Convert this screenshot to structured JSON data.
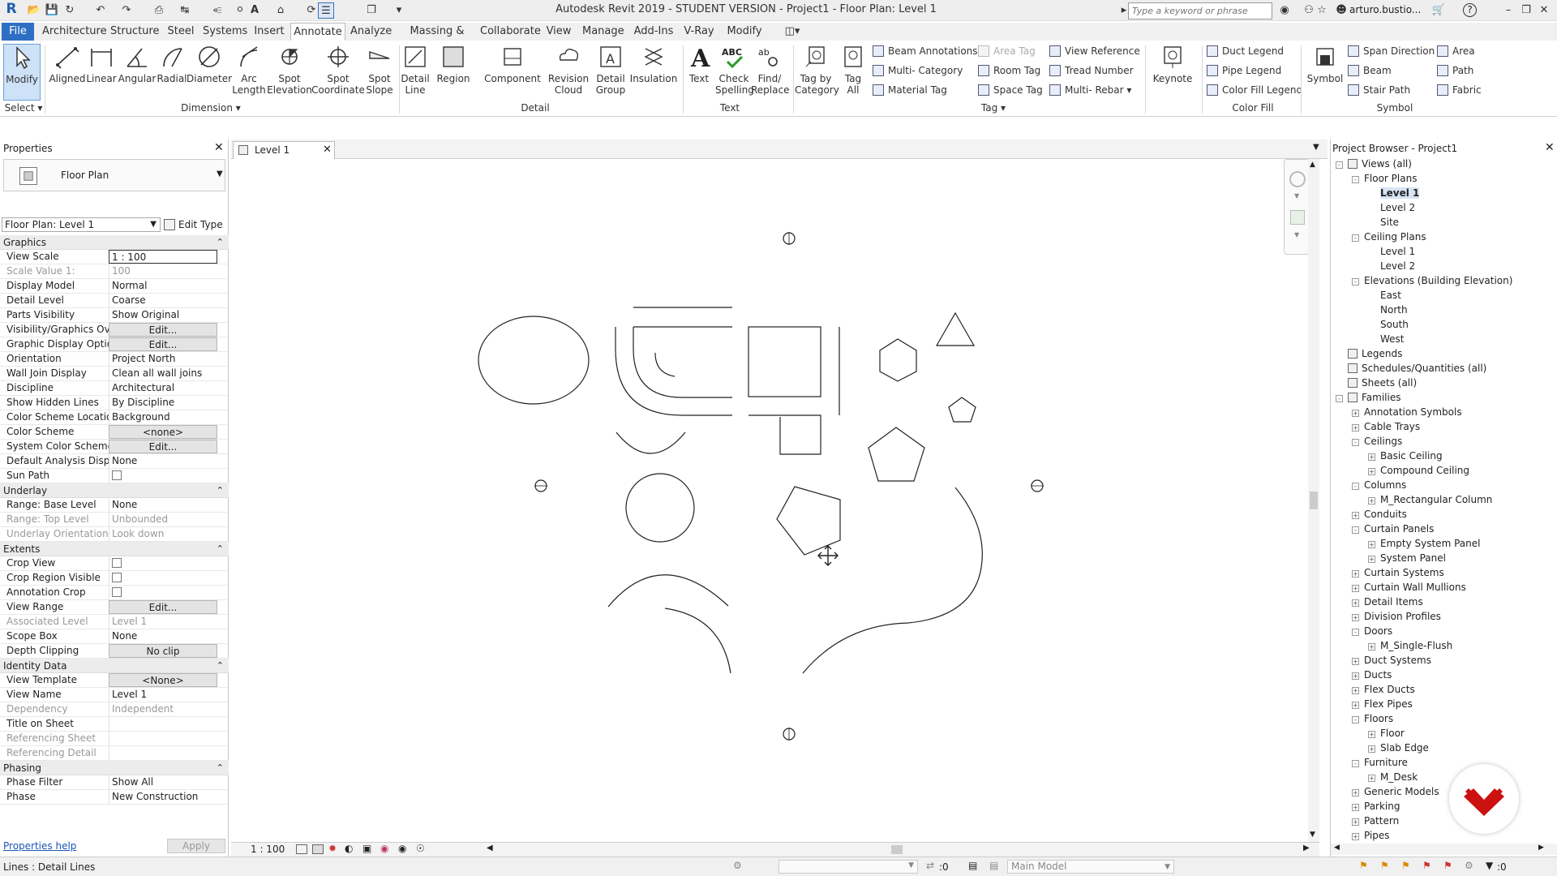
{
  "window": {
    "title": "Autodesk Revit 2019 - STUDENT VERSION - Project1 - Floor Plan: Level 1",
    "search_placeholder": "Type a keyword or phrase",
    "user": "arturo.bustio...",
    "help": "?",
    "logo": "R"
  },
  "tabs": [
    "File",
    "Architecture",
    "Structure",
    "Steel",
    "Systems",
    "Insert",
    "Annotate",
    "Analyze",
    "Massing & Site",
    "Collaborate",
    "View",
    "Manage",
    "Add-Ins",
    "V-Ray",
    "Modify"
  ],
  "active_tab": "Annotate",
  "ribbon": {
    "modify": "Modify",
    "dimension": [
      "Aligned",
      "Linear",
      "Angular",
      "Radial",
      "Diameter",
      "Arc\nLength",
      "Spot\nElevation",
      "Spot\nCoordinate",
      "Spot\nSlope"
    ],
    "detail": [
      "Detail\nLine",
      "Region",
      "Component",
      "Revision\nCloud",
      "Detail\nGroup",
      "Insulation"
    ],
    "text": [
      "Text",
      "Check\nSpelling",
      "Find/\nReplace"
    ],
    "tag_big": [
      "Tag by\nCategory",
      "Tag\nAll"
    ],
    "tag_small": [
      "Beam Annotations",
      "Multi- Category",
      "Material Tag",
      "Area Tag",
      "Room Tag",
      "Space Tag",
      "View Reference",
      "Tread Number",
      "Multi- Rebar"
    ],
    "keynote": "Keynote",
    "colorfill_small": [
      "Duct Legend",
      "Pipe Legend",
      "Color Fill Legend"
    ],
    "symbol": "Symbol",
    "symbol_small": [
      "Span Direction",
      "Beam",
      "Stair Path",
      "Area",
      "Path",
      "Fabric"
    ],
    "groups": [
      "Select",
      "Dimension",
      "Detail",
      "Text",
      "Tag",
      "Color Fill",
      "Symbol"
    ]
  },
  "properties": {
    "title": "Properties",
    "type_name": "Floor Plan",
    "selector": "Floor Plan: Level 1",
    "edit_type": "Edit Type",
    "sections": [
      {
        "name": "Graphics",
        "rows": [
          [
            "View Scale",
            "1 : 100"
          ],
          [
            "Scale Value    1:",
            "100"
          ],
          [
            "Display Model",
            "Normal"
          ],
          [
            "Detail Level",
            "Coarse"
          ],
          [
            "Parts Visibility",
            "Show Original"
          ],
          [
            "Visibility/Graphics Ov...",
            "Edit..."
          ],
          [
            "Graphic Display Optio...",
            "Edit..."
          ],
          [
            "Orientation",
            "Project North"
          ],
          [
            "Wall Join Display",
            "Clean all wall joins"
          ],
          [
            "Discipline",
            "Architectural"
          ],
          [
            "Show Hidden Lines",
            "By Discipline"
          ],
          [
            "Color Scheme Location",
            "Background"
          ],
          [
            "Color Scheme",
            "<none>"
          ],
          [
            "System Color Schemes",
            "Edit..."
          ],
          [
            "Default Analysis Displ...",
            "None"
          ],
          [
            "Sun Path",
            ""
          ]
        ]
      },
      {
        "name": "Underlay",
        "rows": [
          [
            "Range: Base Level",
            "None"
          ],
          [
            "Range: Top Level",
            "Unbounded"
          ],
          [
            "Underlay Orientation",
            "Look down"
          ]
        ]
      },
      {
        "name": "Extents",
        "rows": [
          [
            "Crop View",
            ""
          ],
          [
            "Crop Region Visible",
            ""
          ],
          [
            "Annotation Crop",
            ""
          ],
          [
            "View Range",
            "Edit..."
          ],
          [
            "Associated Level",
            "Level 1"
          ],
          [
            "Scope Box",
            "None"
          ],
          [
            "Depth Clipping",
            "No clip"
          ]
        ]
      },
      {
        "name": "Identity Data",
        "rows": [
          [
            "View Template",
            "<None>"
          ],
          [
            "View Name",
            "Level 1"
          ],
          [
            "Dependency",
            "Independent"
          ],
          [
            "Title on Sheet",
            ""
          ],
          [
            "Referencing Sheet",
            ""
          ],
          [
            "Referencing Detail",
            ""
          ]
        ]
      },
      {
        "name": "Phasing",
        "rows": [
          [
            "Phase Filter",
            "Show All"
          ],
          [
            "Phase",
            "New Construction"
          ]
        ]
      }
    ],
    "help_link": "Properties help",
    "apply": "Apply"
  },
  "view": {
    "tab": "Level 1",
    "scale": "1 : 100"
  },
  "browser": {
    "title": "Project Browser - Project1",
    "nodes": [
      [
        0,
        "-",
        "Views (all)"
      ],
      [
        1,
        "-",
        "Floor Plans"
      ],
      [
        2,
        "",
        "Level 1"
      ],
      [
        2,
        "",
        "Level 2"
      ],
      [
        2,
        "",
        "Site"
      ],
      [
        1,
        "-",
        "Ceiling Plans"
      ],
      [
        2,
        "",
        "Level 1"
      ],
      [
        2,
        "",
        "Level 2"
      ],
      [
        1,
        "-",
        "Elevations (Building Elevation)"
      ],
      [
        2,
        "",
        "East"
      ],
      [
        2,
        "",
        "North"
      ],
      [
        2,
        "",
        "South"
      ],
      [
        2,
        "",
        "West"
      ],
      [
        0,
        "",
        "Legends"
      ],
      [
        0,
        "",
        "Schedules/Quantities (all)"
      ],
      [
        0,
        "",
        "Sheets (all)"
      ],
      [
        0,
        "-",
        "Families"
      ],
      [
        1,
        "+",
        "Annotation Symbols"
      ],
      [
        1,
        "+",
        "Cable Trays"
      ],
      [
        1,
        "-",
        "Ceilings"
      ],
      [
        2,
        "+",
        "Basic Ceiling"
      ],
      [
        2,
        "+",
        "Compound Ceiling"
      ],
      [
        1,
        "-",
        "Columns"
      ],
      [
        2,
        "+",
        "M_Rectangular Column"
      ],
      [
        1,
        "+",
        "Conduits"
      ],
      [
        1,
        "-",
        "Curtain Panels"
      ],
      [
        2,
        "+",
        "Empty System Panel"
      ],
      [
        2,
        "+",
        "System Panel"
      ],
      [
        1,
        "+",
        "Curtain Systems"
      ],
      [
        1,
        "+",
        "Curtain Wall Mullions"
      ],
      [
        1,
        "+",
        "Detail Items"
      ],
      [
        1,
        "+",
        "Division Profiles"
      ],
      [
        1,
        "-",
        "Doors"
      ],
      [
        2,
        "+",
        "M_Single-Flush"
      ],
      [
        1,
        "+",
        "Duct Systems"
      ],
      [
        1,
        "+",
        "Ducts"
      ],
      [
        1,
        "+",
        "Flex Ducts"
      ],
      [
        1,
        "+",
        "Flex Pipes"
      ],
      [
        1,
        "-",
        "Floors"
      ],
      [
        2,
        "+",
        "Floor"
      ],
      [
        2,
        "+",
        "Slab Edge"
      ],
      [
        1,
        "-",
        "Furniture"
      ],
      [
        2,
        "+",
        "M_Desk"
      ],
      [
        1,
        "+",
        "Generic Models"
      ],
      [
        1,
        "+",
        "Parking"
      ],
      [
        1,
        "+",
        "Pattern"
      ],
      [
        1,
        "+",
        "Pipes"
      ]
    ]
  },
  "status": {
    "text": "Lines : Detail Lines",
    "model": "Main Model",
    "zero1": ":0",
    "zero2": ":0"
  },
  "colors": {
    "accent": "#2e6fc4",
    "brand": "#cc1111"
  }
}
